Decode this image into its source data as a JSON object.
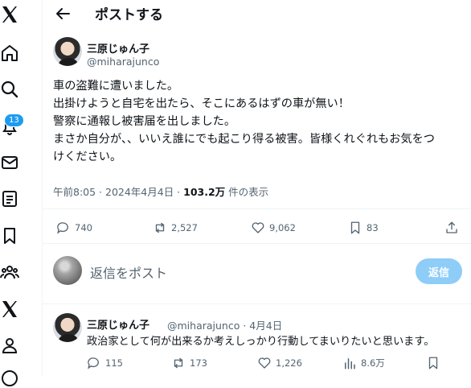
{
  "header": {
    "title": "ポストする"
  },
  "sidebar": {
    "notification_count": "13"
  },
  "post": {
    "author_name": "三原じゅん子",
    "author_handle": "@miharajunco",
    "text_lines": [
      "車の盗難に遭いました。",
      "出掛けようと自宅を出たら、そこにあるはずの車が無い！",
      "警察に通報し被害届を出しました。",
      "まさか自分が、、いいえ誰にでも起こり得る被害。皆様くれぐれもお気をつ",
      "けください。"
    ],
    "timestamp": "午前8:05 · 2024年4月4日 · ",
    "views_count": "103.2万",
    "views_label": " 件の表示",
    "replies": "740",
    "reposts": "2,527",
    "likes": "9,062",
    "bookmarks": "83"
  },
  "reply_composer": {
    "placeholder": "返信をポスト",
    "button_label": "返信"
  },
  "reply": {
    "author_name": "三原じゅん子",
    "author_handle": "@miharajunco · 4月4日",
    "text": "政治家として何が出来るか考えしっかり行動してまいりたいと思います。",
    "replies": "115",
    "reposts": "173",
    "likes": "1,226",
    "views": "8.6万"
  },
  "colors": {
    "accent": "#1d9bf0",
    "reply_button": "#8ecdf7",
    "muted_text": "#536471"
  }
}
